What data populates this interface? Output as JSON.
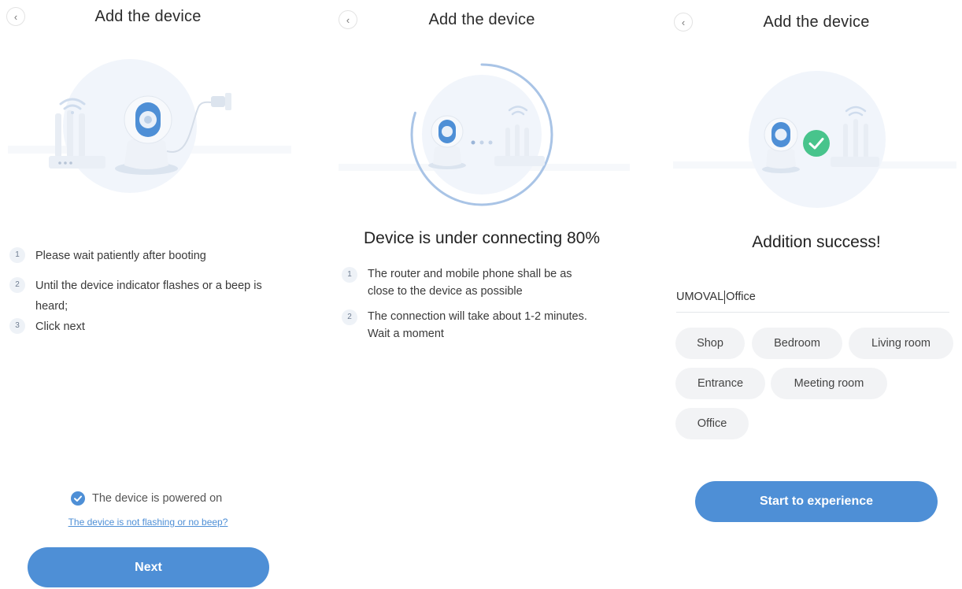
{
  "colors": {
    "accent": "#4e8fd6",
    "success": "#48c48c",
    "chip_bg": "#f2f3f5"
  },
  "panel1": {
    "title": "Add the device",
    "steps": [
      {
        "num": "1",
        "text": "Please wait patiently after booting"
      },
      {
        "num": "2",
        "text": "Until the device indicator flashes or a beep is heard;"
      },
      {
        "num": "3",
        "text": "Click next"
      }
    ],
    "checkbox_label": "The device is powered on",
    "checkbox_checked": true,
    "help_link": "The device is not flashing or no beep?",
    "next_label": "Next"
  },
  "panel2": {
    "title": "Add the device",
    "status": "Device is under connecting 80%",
    "progress_percent": 80,
    "steps": [
      {
        "num": "1",
        "text": "The router and mobile phone shall be as close to the device as possible"
      },
      {
        "num": "2",
        "text": "The connection will take about 1-2 minutes. Wait a moment"
      }
    ]
  },
  "panel3": {
    "title": "Add the device",
    "heading": "Addition success!",
    "name_prefix": "UMOVAL ",
    "name_value": "Office",
    "rooms": [
      "Shop",
      "Bedroom",
      "Living room",
      "Entrance",
      "Meeting room",
      "Office"
    ],
    "start_label": "Start to experience"
  },
  "icons": {
    "back": "chevron-left-icon",
    "check": "checkmark-icon",
    "wifi": "wifi-icon",
    "camera": "camera-icon",
    "router": "router-icon"
  }
}
